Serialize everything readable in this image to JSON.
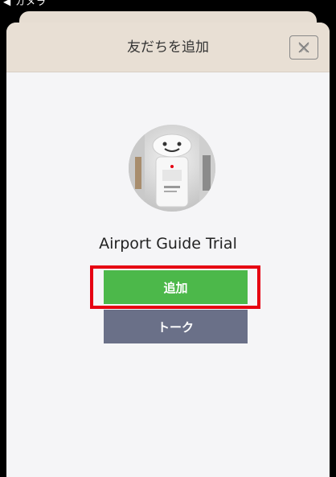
{
  "status_bar": {
    "text": "◀ カメラ"
  },
  "dialog": {
    "title": "友だちを追加",
    "close_label": "閉じる"
  },
  "profile": {
    "name": "Airport Guide Trial"
  },
  "actions": {
    "add_label": "追加",
    "talk_label": "トーク"
  },
  "colors": {
    "header_bg": "#e8dfd4",
    "add_button": "#4cb84a",
    "talk_button": "#6a7088",
    "highlight_border": "#e60012"
  }
}
